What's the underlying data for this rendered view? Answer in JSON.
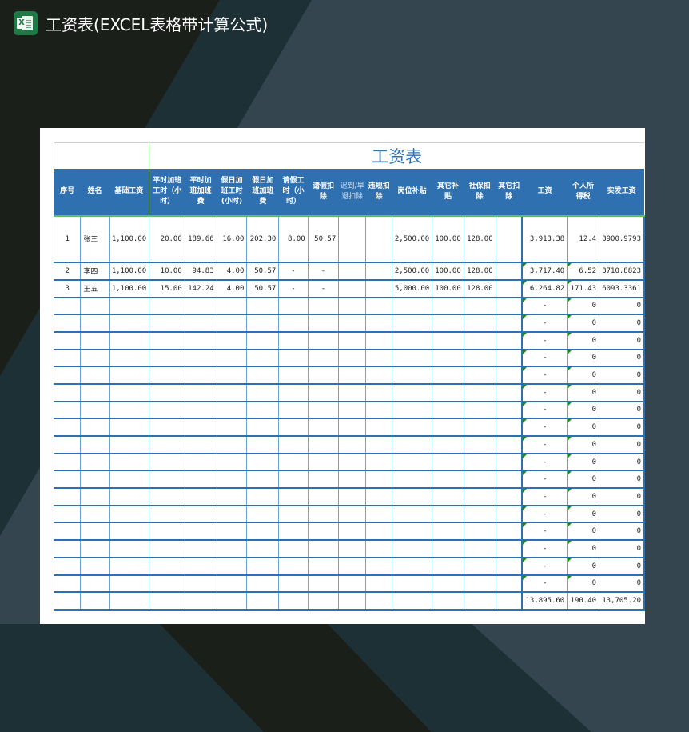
{
  "app": {
    "title": "工资表(EXCEL表格带计算公式)",
    "icon": "excel-icon",
    "icon_letter": "X"
  },
  "colors": {
    "header_blue": "#2f70b0",
    "title_blue": "#2e74b5",
    "grid_blue": "#2f6fb3",
    "formula_green": "#1a8a1a",
    "excel_green": "#1f7a45"
  },
  "sheet": {
    "title": "工资表",
    "columns": [
      "序号",
      "姓名",
      "基础工资",
      "平时加班工时（小时）",
      "平时加班加班费",
      "假日加班工时(小时)",
      "假日加班加班费",
      "请假工时（小时）",
      "请假扣除",
      "迟到/早退扣除",
      "违规扣除",
      "岗位补贴",
      "其它补贴",
      "社保扣除",
      "其它扣除",
      "工资",
      "个人所得税",
      "实发工资"
    ],
    "rows": [
      [
        "1",
        "张三",
        "1,100.00",
        "20.00",
        "189.66",
        "16.00",
        "202.30",
        "8.00",
        "50.57",
        "",
        "",
        "2,500.00",
        "100.00",
        "128.00",
        "",
        "3,913.38",
        "12.4",
        "3900.9793"
      ],
      [
        "2",
        "李四",
        "1,100.00",
        "10.00",
        "94.83",
        "4.00",
        "50.57",
        "-",
        "-",
        "",
        "",
        "2,500.00",
        "100.00",
        "128.00",
        "",
        "3,717.40",
        "6.52",
        "3710.8823"
      ],
      [
        "3",
        "王五",
        "1,100.00",
        "15.00",
        "142.24",
        "4.00",
        "50.57",
        "-",
        "-",
        "",
        "",
        "5,000.00",
        "100.00",
        "128.00",
        "",
        "6,264.82",
        "171.43",
        "6093.3361"
      ]
    ],
    "empty_row_count": 17,
    "empty_row_values": {
      "salary": "-",
      "tax": "0",
      "net": "0"
    },
    "totals": {
      "salary": "13,895.60",
      "tax": "190.40",
      "net": "13,705.20"
    }
  }
}
